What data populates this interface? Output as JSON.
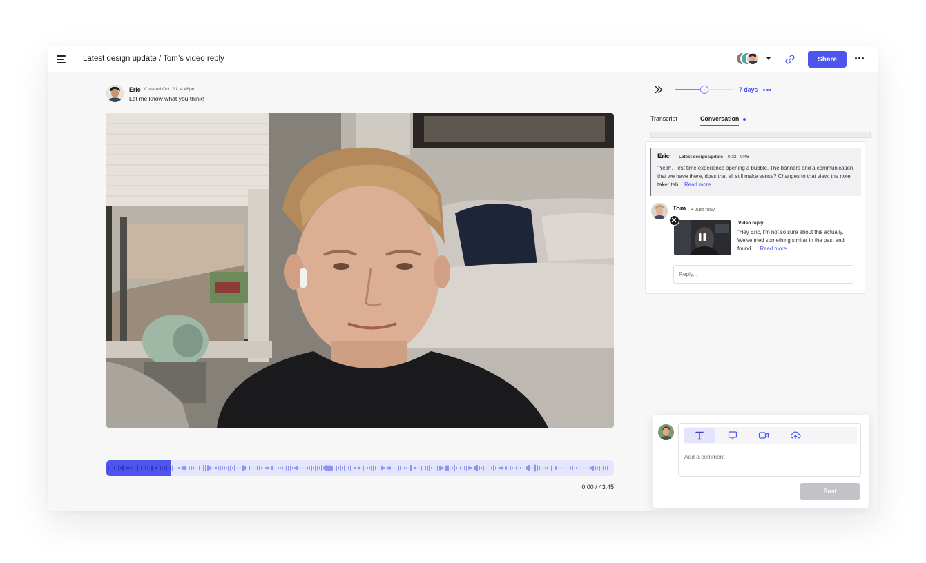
{
  "header": {
    "title": "Latest design update / Tom’s video reply",
    "share_label": "Share",
    "icons": [
      "menu-icon",
      "chevron-down-icon",
      "link-icon",
      "more-icon"
    ]
  },
  "post": {
    "author": "Eric",
    "created": "Created Oct. 21, 4:46pm",
    "caption": "Let me know what you think!"
  },
  "player": {
    "time": "0:00 / 43:45",
    "played_fraction": 0.127
  },
  "sidebar": {
    "expiry_label": "7 days",
    "expiry_fraction": 0.5,
    "tabs": [
      {
        "label": "Transcript",
        "active": false
      },
      {
        "label": "Conversation",
        "active": true
      }
    ]
  },
  "conversation": {
    "quote": {
      "author": "Eric",
      "source": "Latest design update",
      "range": "0:32 - 0:46",
      "text": "\"Yeah. First time experience opening a bubble. The banners and a communication that we have there, does that all still make sense? Changes to that view, the note taker tab.",
      "read_more": "Read more"
    },
    "reply": {
      "author": "Tom",
      "time": "• Just now",
      "label": "Video reply",
      "text": "\"Hey Eric, I'm not so sure about this actually. We've tried something similar in the past and found...",
      "read_more": "Read more"
    },
    "reply_placeholder": "Reply..."
  },
  "composer": {
    "placeholder": "Add a comment",
    "post_label": "Post",
    "tools": [
      "text-tool-icon",
      "screen-record-icon",
      "camera-icon",
      "upload-icon"
    ]
  },
  "colors": {
    "accent": "#4d55ee",
    "waveform_played": "#5a61ee",
    "waveform_unplayed": "#8f94f3",
    "waveform_bg": "#e5e7fd"
  }
}
